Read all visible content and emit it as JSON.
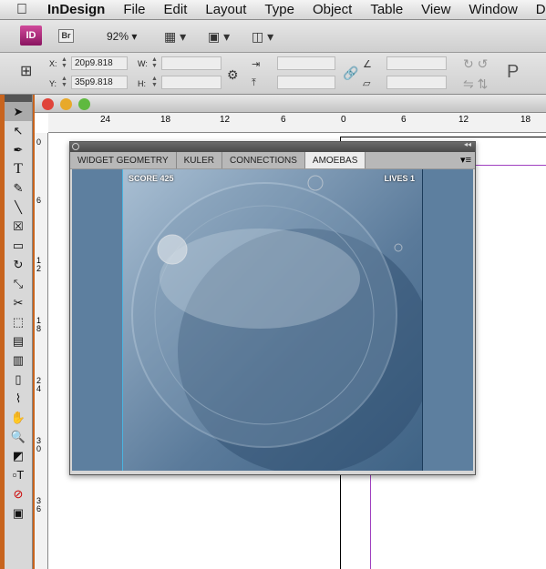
{
  "menubar": {
    "apple": "",
    "app": "InDesign",
    "items": [
      "File",
      "Edit",
      "Layout",
      "Type",
      "Object",
      "Table",
      "View",
      "Window",
      "Dev"
    ]
  },
  "control": {
    "app_badge": "ID",
    "bridge": "Br",
    "zoom": "92%",
    "x_label": "X:",
    "x_value": "20p9.818",
    "y_label": "Y:",
    "y_value": "35p9.818",
    "w_label": "W:",
    "w_value": "",
    "h_label": "H:",
    "h_value": "",
    "para_glyph": "P"
  },
  "ruler": {
    "top": [
      "24",
      "18",
      "12",
      "6",
      "0",
      "6",
      "12",
      "18"
    ],
    "left": [
      "0",
      "6",
      "1 2",
      "1 8",
      "2 4",
      "3 0",
      "3 6"
    ]
  },
  "panel": {
    "tabs": [
      "WIDGET GEOMETRY",
      "KULER",
      "CONNECTIONS",
      "AMOEBAS"
    ],
    "active_tab": "AMOEBAS"
  },
  "game": {
    "score": "SCORE 425",
    "lives": "LIVES 1"
  },
  "colors": {
    "accent": "#4bb4e0",
    "guide": "#a040c0"
  }
}
